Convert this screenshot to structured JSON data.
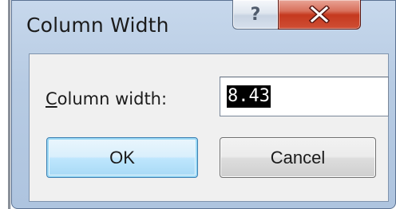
{
  "dialog": {
    "title": "Column Width",
    "help_glyph": "?",
    "field_label_mnemonic": "C",
    "field_label_rest": "olumn width:",
    "field_value": "8.43",
    "ok_label": "OK",
    "cancel_label": "Cancel"
  },
  "icons": {
    "help": "help-icon",
    "close": "close-icon"
  },
  "colors": {
    "titlebar": "#b7cbe3",
    "close_button": "#c5391f",
    "default_button_border": "#3c7fb1",
    "selection": "#000000"
  }
}
